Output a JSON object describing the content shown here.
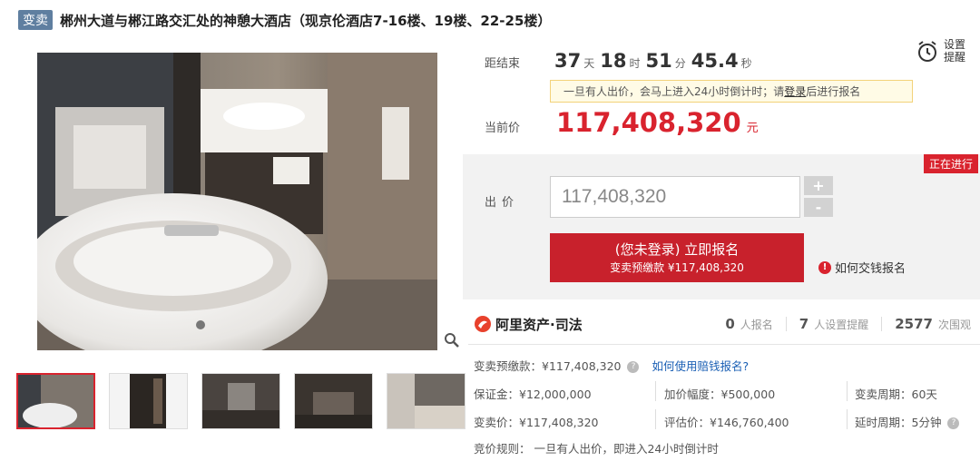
{
  "header": {
    "tag": "变卖",
    "title": "郴州大道与郴江路交汇处的神憩大酒店（现京伦酒店7-16楼、19楼、22-25楼）"
  },
  "countdown": {
    "label": "距结束",
    "days": "37",
    "days_unit": "天",
    "hours": "18",
    "hours_unit": "时",
    "minutes": "51",
    "minutes_unit": "分",
    "seconds": "45.4",
    "seconds_unit": "秒"
  },
  "reminder": {
    "label_line1": "设置",
    "label_line2": "提醒"
  },
  "notice": {
    "text": "一旦有人出价，会马上进入24小时倒计时；请",
    "link": "登录",
    "text_after": "后进行报名"
  },
  "current_price": {
    "label": "当前价",
    "value": "117,408,320",
    "unit": "元"
  },
  "bid": {
    "status": "正在进行",
    "label": "出价",
    "input_value": "117,408,320",
    "plus": "+",
    "minus": "-",
    "signup_main": "(您未登录) 立即报名",
    "signup_sub": "变卖预缴款 ¥117,408,320",
    "howto": "如何交钱报名"
  },
  "platform": {
    "name": "阿里资产·司法",
    "signups": "0",
    "signups_label": "人报名",
    "reminders": "7",
    "reminders_label": "人设置提醒",
    "views": "2577",
    "views_label": "次围观"
  },
  "details": {
    "deposit_prepay": "变卖预缴款：¥117,408,320",
    "compensation_link": "如何使用赔钱报名?",
    "margin": "保证金：¥12,000,000",
    "increment": "加价幅度：¥500,000",
    "period": "变卖周期：60天",
    "sale_price": "变卖价：¥117,408,320",
    "appraisal": "评估价：¥146,760,400",
    "extension": "延时周期：5分钟",
    "rule": "竞价规则：  一旦有人出价，即进入24小时倒计时"
  },
  "colors": {
    "accent": "#d9232e",
    "tag": "#5f7fa0",
    "link": "#1a5fb4"
  }
}
